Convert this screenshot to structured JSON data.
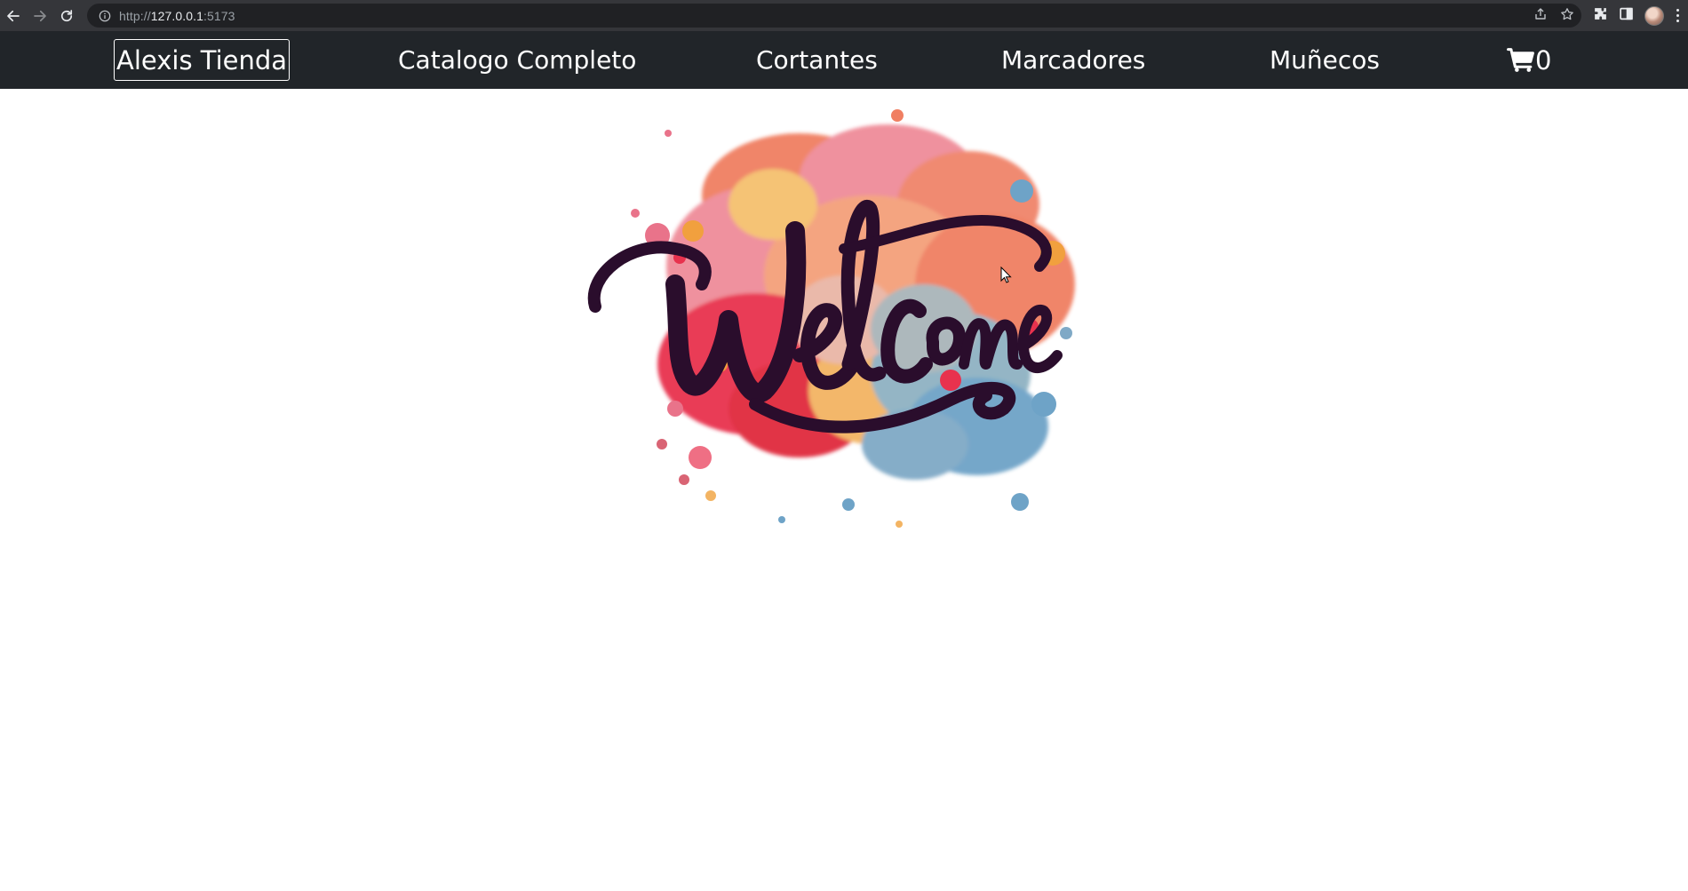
{
  "browser": {
    "url_scheme": "http://",
    "url_host": "127.0.0.1",
    "url_port": ":5173",
    "icons": [
      "back-icon",
      "forward-icon",
      "reload-icon",
      "info-icon",
      "share-icon",
      "star-icon",
      "extensions-icon",
      "side-panel-icon",
      "profile-avatar",
      "menu-icon"
    ]
  },
  "navbar": {
    "brand": "Alexis Tienda",
    "links": [
      "Catalogo Completo",
      "Cortantes",
      "Marcadores",
      "Muñecos"
    ],
    "cart_count": "0",
    "cart_icon": "cart-icon",
    "background": "#212529",
    "text_color": "#ffffff"
  },
  "hero": {
    "welcome_text": "Welcome",
    "letter_color": "#2a0d2c",
    "splash_colors": [
      "#f07f62",
      "#ef8c99",
      "#e8324e",
      "#f3b463",
      "#6ea3c7",
      "#8fb2c2"
    ]
  }
}
